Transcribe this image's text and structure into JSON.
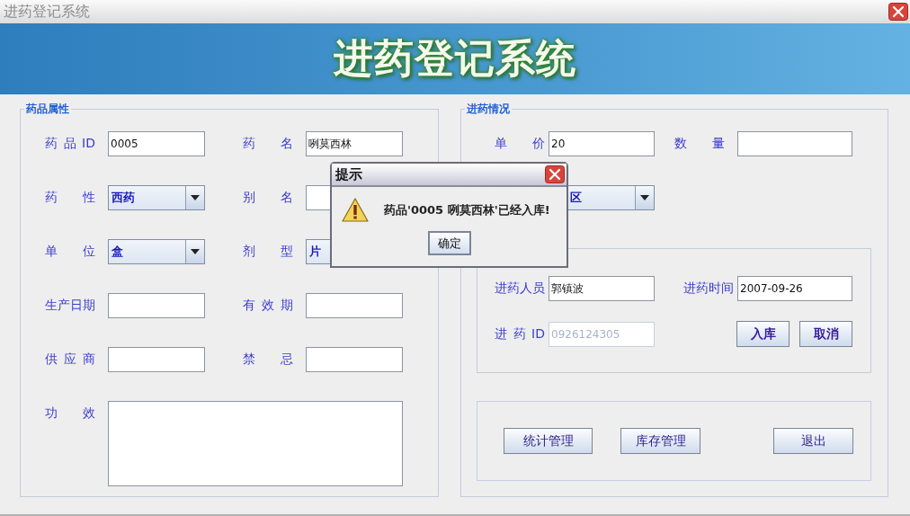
{
  "window": {
    "title": "进药登记系统"
  },
  "banner": {
    "title": "进药登记系统"
  },
  "drug_properties": {
    "legend": "药品属性",
    "fields": [
      {
        "label": "药 品 ID",
        "kind": "text",
        "value": "0005"
      },
      {
        "label": "药 名",
        "kind": "text",
        "value": "咧莫西林"
      },
      {
        "label": "药 性",
        "kind": "combo",
        "value": "西药"
      },
      {
        "label": "别 名",
        "kind": "text"
      },
      {
        "label": "单 位",
        "kind": "combo",
        "value": "盒"
      },
      {
        "label": "剂 型",
        "kind": "combo",
        "value": "片"
      },
      {
        "label": "生产日期",
        "kind": "text"
      },
      {
        "label": "有 效 期",
        "kind": "text"
      },
      {
        "label": "供 应 商",
        "kind": "text"
      },
      {
        "label": "禁 忌",
        "kind": "text"
      },
      {
        "label": "功 效",
        "kind": "textarea"
      }
    ]
  },
  "intake": {
    "legend": "进药情况",
    "fields": [
      {
        "label": "单 价",
        "kind": "text",
        "value": "20"
      },
      {
        "label": "数 量",
        "kind": "text"
      },
      {
        "kind": "combo",
        "value": "区"
      }
    ],
    "entry": {
      "fields": [
        {
          "label": "进药人员",
          "kind": "text",
          "value": "郭镇波",
          "disabled": false
        },
        {
          "label": "进药时间",
          "kind": "text",
          "value": "2007-09-26",
          "disabled": false
        },
        {
          "label": "进 药 ID",
          "kind": "text",
          "value": "0926124305",
          "disabled": true
        }
      ],
      "buttons": [
        "入库",
        "取消"
      ]
    },
    "actions": [
      "统计管理",
      "库存管理",
      "退出"
    ]
  },
  "dialog": {
    "title": "提示",
    "message": "药品'0005 咧莫西林'已经入库!",
    "button": "确定"
  }
}
